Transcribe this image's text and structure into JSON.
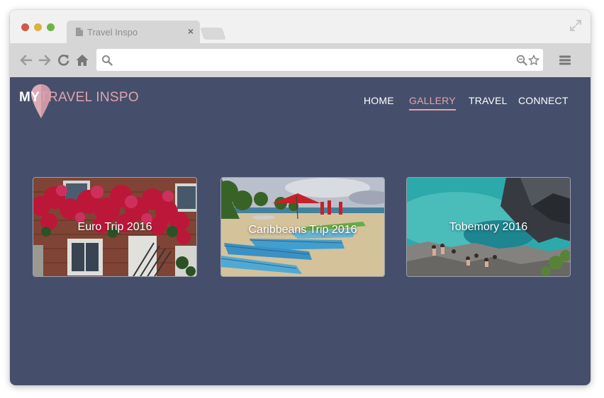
{
  "browser": {
    "tab_title": "Travel Inspo",
    "tab_close": "×",
    "url_value": ""
  },
  "site": {
    "logo_my": "MY",
    "logo_rest": "TRAVEL INSPO",
    "nav": {
      "home": "HOME",
      "gallery": "GALLERY",
      "travel": "TRAVEL",
      "connect": "CONNECT",
      "active": "gallery"
    },
    "gallery": [
      {
        "title": "Euro Trip 2016",
        "image": "house-with-red-bougainvillea"
      },
      {
        "title": "Caribbeans Trip 2016",
        "image": "beach-with-blue-kayaks"
      },
      {
        "title": "Tobemory 2016",
        "image": "turquoise-water-rocky-cove"
      }
    ]
  },
  "colors": {
    "page_bg": "#454f6b",
    "accent_pink": "#e0a3ad",
    "toolbar_bg": "#d6d6d6"
  }
}
